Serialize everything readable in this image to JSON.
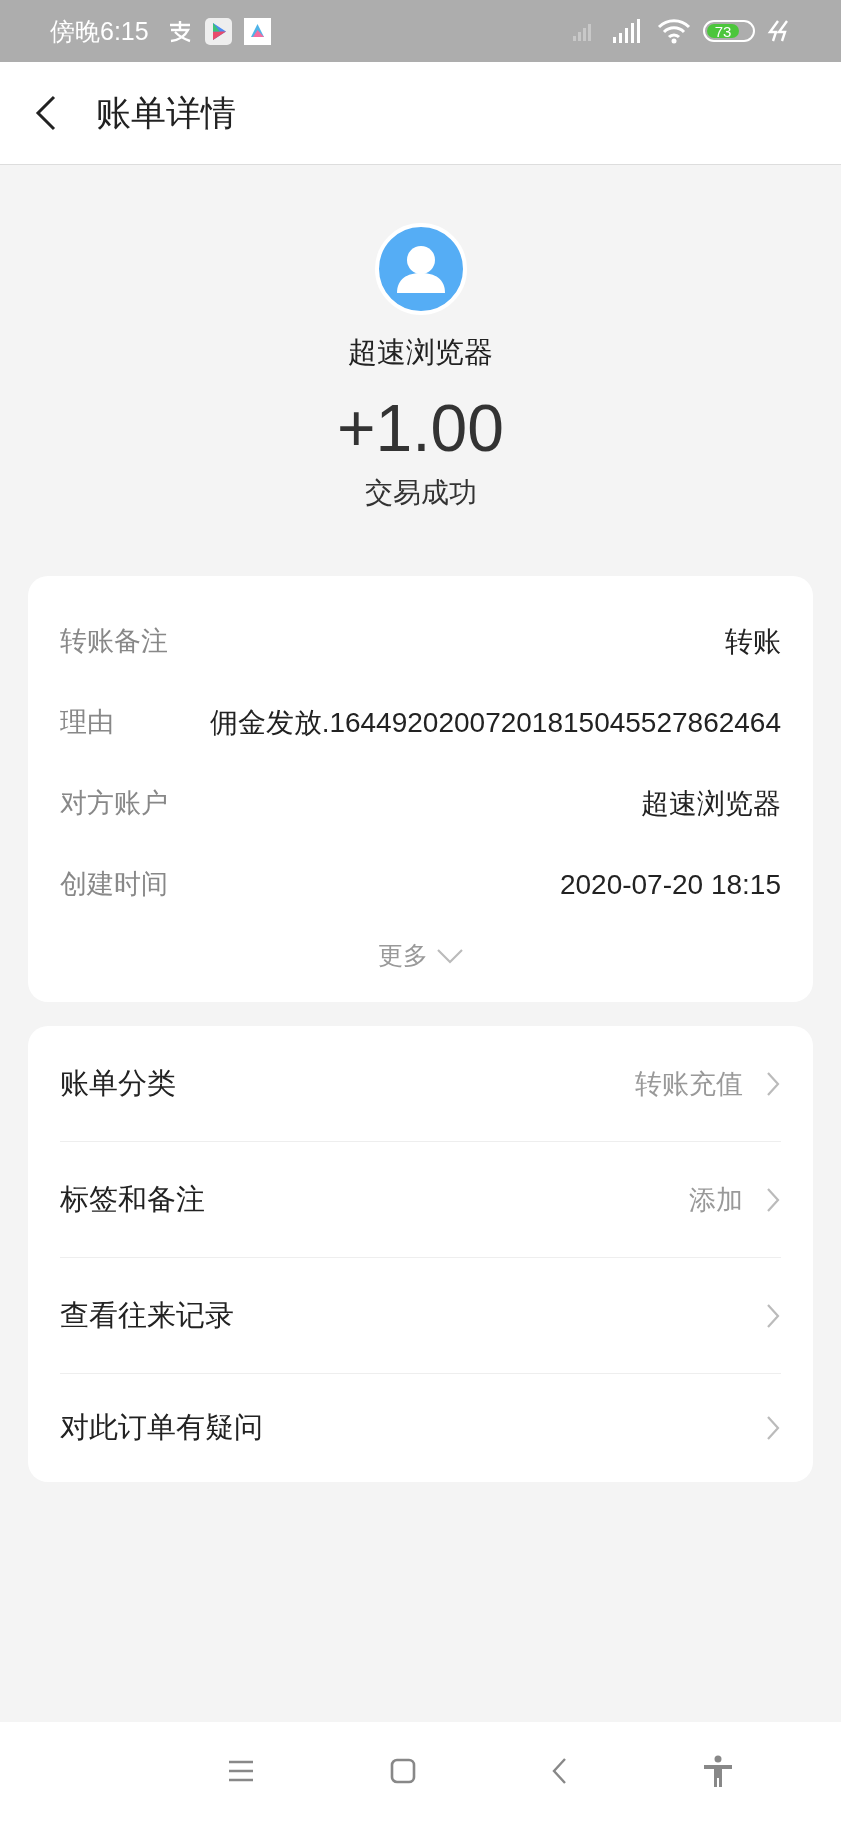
{
  "status_bar": {
    "time": "傍晚6:15",
    "battery": "73"
  },
  "header": {
    "title": "账单详情"
  },
  "summary": {
    "name": "超速浏览器",
    "amount": "+1.00",
    "status": "交易成功"
  },
  "details": {
    "rows": [
      {
        "label": "转账备注",
        "value": "转账"
      },
      {
        "label": "理由",
        "value": "佣金发放.16449202007201815045527862464"
      },
      {
        "label": "对方账户",
        "value": "超速浏览器"
      },
      {
        "label": "创建时间",
        "value": "2020-07-20 18:15"
      }
    ],
    "more": "更多"
  },
  "actions": [
    {
      "label": "账单分类",
      "value": "转账充值"
    },
    {
      "label": "标签和备注",
      "value": "添加"
    },
    {
      "label": "查看往来记录"
    },
    {
      "label": "对此订单有疑问"
    }
  ]
}
